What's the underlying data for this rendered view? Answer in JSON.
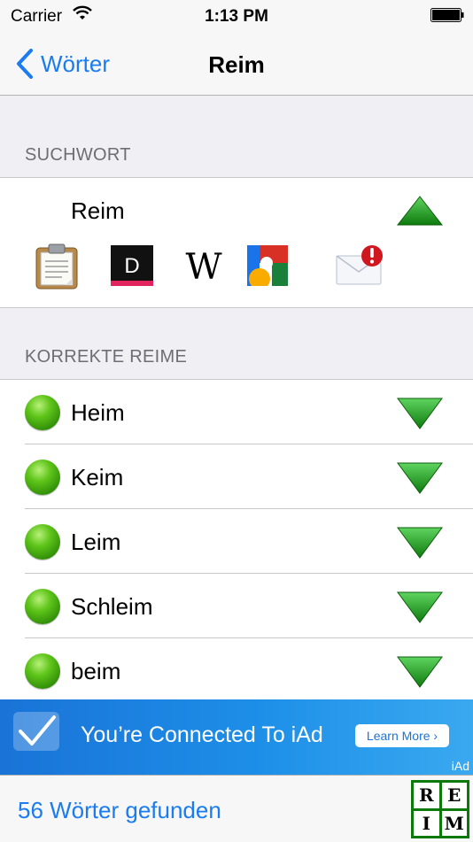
{
  "status": {
    "carrier": "Carrier",
    "time": "1:13 PM"
  },
  "nav": {
    "back_label": "Wörter",
    "title": "Reim"
  },
  "sections": {
    "search_header": "SUCHWORT",
    "rhymes_header": "KORREKTE REIME"
  },
  "search": {
    "word": "Reim",
    "duden_letter": "D",
    "wiki_letter": "W"
  },
  "rhymes": [
    {
      "word": "Heim"
    },
    {
      "word": "Keim"
    },
    {
      "word": "Leim"
    },
    {
      "word": "Schleim"
    },
    {
      "word": "beim"
    }
  ],
  "ad": {
    "text": "You’re Connected To iAd",
    "button": "Learn More ›",
    "badge": "iAd"
  },
  "footer": {
    "count_text": "56 Wörter gefunden"
  },
  "logo": {
    "letters": [
      "R",
      "E",
      "I",
      "M"
    ]
  },
  "colors": {
    "accent": "#1a7cf0",
    "triangle": "#1a8c1a",
    "status_dot": "#4cb814"
  }
}
